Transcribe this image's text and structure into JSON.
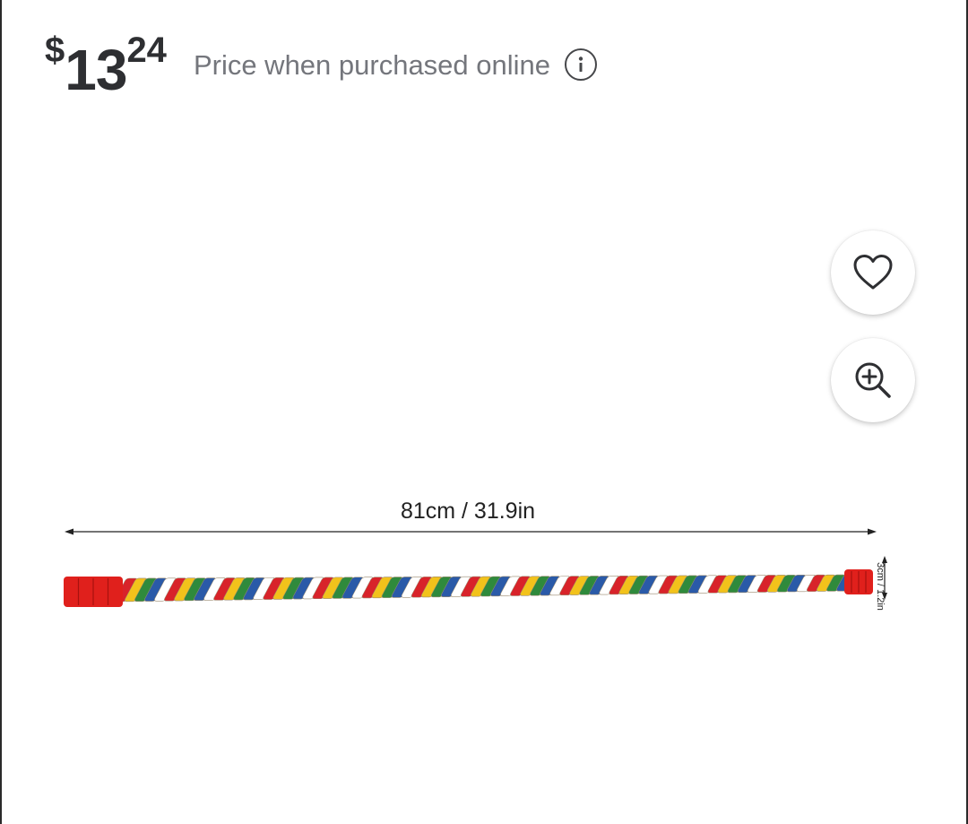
{
  "price": {
    "currency": "$",
    "whole": "13",
    "cents": "24",
    "note": "Price when purchased online"
  },
  "actions": {
    "info_icon": "info-circle-icon",
    "favorite_icon": "heart-icon",
    "zoom_icon": "zoom-in-icon"
  },
  "product_image": {
    "length_label": "81cm / 31.9in",
    "diameter_label": "3cm / 1.2in",
    "end_cap_color": "#e0201c",
    "rope_colors": [
      "#d8232a",
      "#f2c21b",
      "#2f8a3c",
      "#2a5aa8",
      "#ffffff"
    ]
  }
}
